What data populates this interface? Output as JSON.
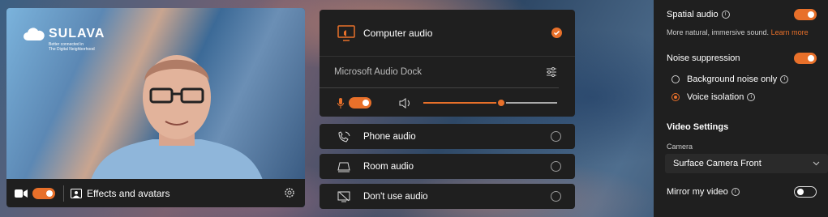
{
  "preview": {
    "logo_name": "SULAVA",
    "logo_tagline_1": "Better connected in",
    "logo_tagline_2": "The Digital Neighborhood",
    "camera_toggle": "on",
    "effects_label": "Effects and avatars"
  },
  "audio": {
    "computer_audio_label": "Computer audio",
    "computer_audio_selected": true,
    "device_label": "Microsoft Audio Dock",
    "mic_toggle": "on",
    "volume_level": 0.58,
    "options": [
      {
        "label": "Phone audio",
        "icon": "phone-audio-icon"
      },
      {
        "label": "Room audio",
        "icon": "room-audio-icon"
      },
      {
        "label": "Don't use audio",
        "icon": "no-audio-icon"
      }
    ]
  },
  "settings": {
    "spatial_audio_label": "Spatial audio",
    "spatial_audio_desc": "More natural, immersive sound.",
    "learn_more": "Learn more",
    "noise_suppression_label": "Noise suppression",
    "background_noise_label": "Background noise only",
    "voice_isolation_label": "Voice isolation",
    "voice_isolation_selected": true,
    "video_settings_label": "Video Settings",
    "camera_label": "Camera",
    "camera_value": "Surface Camera Front",
    "mirror_label": "Mirror my video",
    "mirror_toggle": "off"
  },
  "colors": {
    "accent": "#e8702a",
    "panel": "#1f1f1f"
  }
}
